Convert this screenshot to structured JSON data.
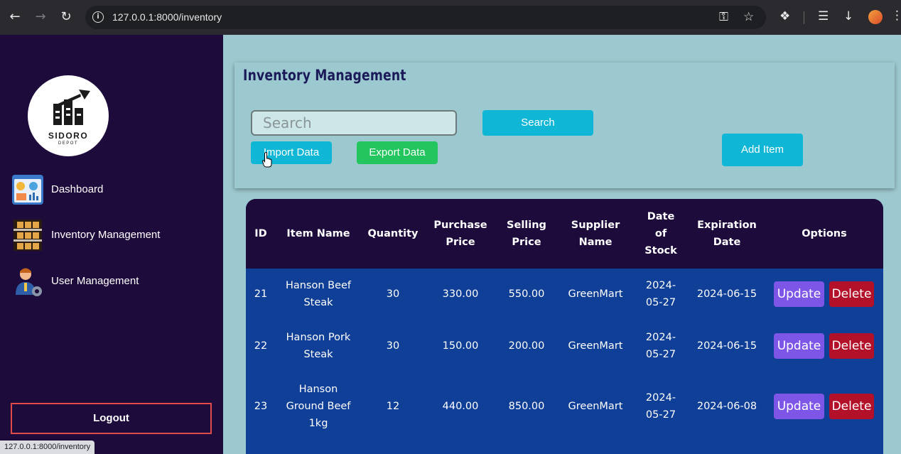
{
  "browser": {
    "url": "127.0.0.1:8000/inventory",
    "status_url": "127.0.0.1:8000/inventory"
  },
  "sidebar": {
    "logo": {
      "name": "SIDORO",
      "tagline": "DEPOT"
    },
    "items": [
      {
        "label": "Dashboard",
        "icon": "dashboard-icon"
      },
      {
        "label": "Inventory Management",
        "icon": "inventory-shelf-icon"
      },
      {
        "label": "User Management",
        "icon": "user-gear-icon"
      }
    ],
    "logout_label": "Logout"
  },
  "header": {
    "title": "Inventory Management",
    "search_placeholder": "Search",
    "search_button": "Search",
    "import_button": "Import Data",
    "export_button": "Export Data",
    "add_button": "Add Item"
  },
  "table": {
    "columns": [
      "ID",
      "Item Name",
      "Quantity",
      "Purchase Price",
      "Selling Price",
      "Supplier Name",
      "Date of Stock",
      "Expiration Date",
      "Options"
    ],
    "rows": [
      {
        "id": "21",
        "name": "Hanson Beef Steak",
        "quantity": "30",
        "purchase_price": "330.00",
        "selling_price": "550.00",
        "supplier": "GreenMart",
        "date_of_stock": "2024-05-27",
        "expiration": "2024-06-15"
      },
      {
        "id": "22",
        "name": "Hanson Pork Steak",
        "quantity": "30",
        "purchase_price": "150.00",
        "selling_price": "200.00",
        "supplier": "GreenMart",
        "date_of_stock": "2024-05-27",
        "expiration": "2024-06-15"
      },
      {
        "id": "23",
        "name": "Hanson Ground Beef 1kg",
        "quantity": "12",
        "purchase_price": "440.00",
        "selling_price": "850.00",
        "supplier": "GreenMart",
        "date_of_stock": "2024-05-27",
        "expiration": "2024-06-08"
      }
    ],
    "update_label": "Update",
    "delete_label": "Delete"
  },
  "colors": {
    "sidebar_bg": "#1d0b3c",
    "page_bg": "#9cc9cf",
    "table_body": "#0f3f96",
    "accent_cyan": "#10b6d6",
    "export_green": "#22c55e",
    "update_purple": "#7d56e8",
    "delete_red": "#b3112a"
  }
}
